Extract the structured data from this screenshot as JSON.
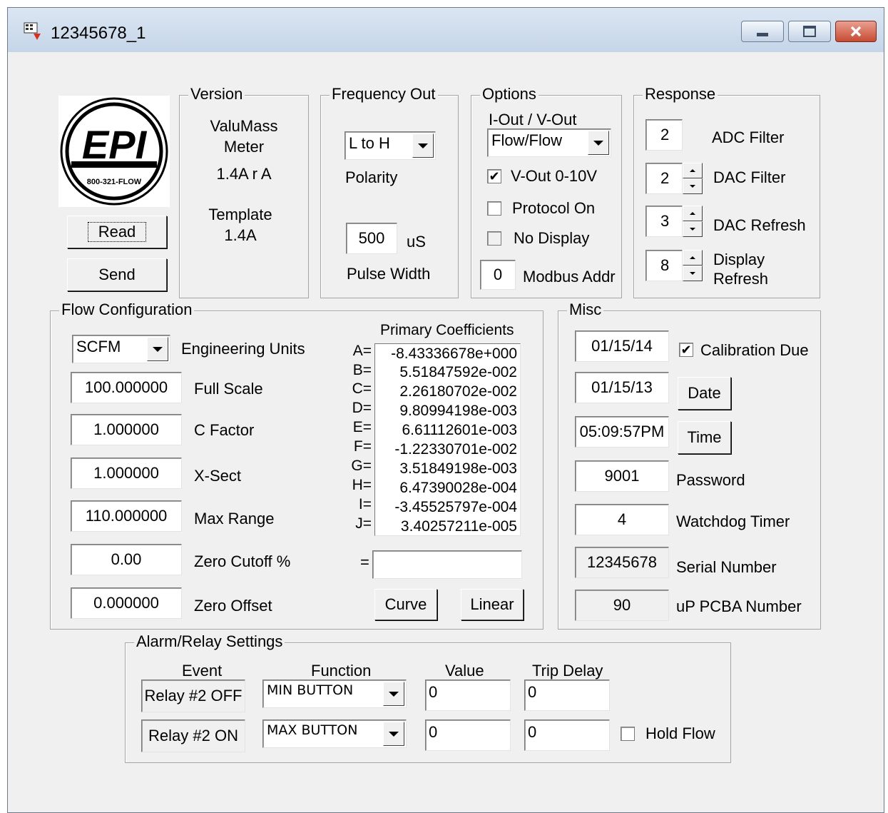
{
  "window": {
    "title": "12345678_1",
    "buttons": {
      "minimize": "minimize",
      "maximize": "maximize",
      "close": "close"
    }
  },
  "logo": {
    "text": "EPI",
    "phone": "800-321-FLOW"
  },
  "actions": {
    "read": "Read",
    "send": "Send"
  },
  "version": {
    "title": "Version",
    "product_line1": "ValuMass",
    "product_line2": "Meter",
    "version": "1.4A r A",
    "template_label": "Template",
    "template_value": "1.4A"
  },
  "frequency_out": {
    "title": "Frequency Out",
    "polarity_value": "L to H",
    "polarity_label": "Polarity",
    "pulse_value": "500",
    "pulse_unit": "uS",
    "pulse_label": "Pulse Width"
  },
  "options": {
    "title": "Options",
    "iout_label": "I-Out / V-Out",
    "iout_value": "Flow/Flow",
    "vout_label": "V-Out 0-10V",
    "vout_checked": true,
    "protocol_label": "Protocol On",
    "protocol_checked": false,
    "nodisplay_label": "No Display",
    "nodisplay_checked": false,
    "modbus_value": "0",
    "modbus_label": "Modbus Addr"
  },
  "response": {
    "title": "Response",
    "adc_value": "2",
    "adc_label": "ADC Filter",
    "dac_value": "2",
    "dac_label": "DAC Filter",
    "refresh_value": "3",
    "refresh_label": "DAC Refresh",
    "display_value": "8",
    "display_label1": "Display",
    "display_label2": "Refresh"
  },
  "flow_config": {
    "title": "Flow Configuration",
    "units_value": "SCFM",
    "units_label": "Engineering Units",
    "full_scale_value": "100.000000",
    "full_scale_label": "Full Scale",
    "c_factor_value": "1.000000",
    "c_factor_label": "C Factor",
    "x_sect_value": "1.000000",
    "x_sect_label": "X-Sect",
    "max_range_value": "110.000000",
    "max_range_label": "Max Range",
    "zero_cutoff_value": "0.00",
    "zero_cutoff_label": "Zero Cutoff %",
    "zero_offset_value": "0.000000",
    "zero_offset_label": "Zero Offset",
    "coef_title": "Primary Coefficients",
    "coefficients": [
      {
        "key": "A=",
        "value": "-8.43336678e+000"
      },
      {
        "key": "B=",
        "value": "5.51847592e-002"
      },
      {
        "key": "C=",
        "value": "2.26180702e-002"
      },
      {
        "key": "D=",
        "value": "9.80994198e-003"
      },
      {
        "key": "E=",
        "value": "6.61112601e-003"
      },
      {
        "key": "F=",
        "value": "-1.22330701e-002"
      },
      {
        "key": "G=",
        "value": "3.51849198e-003"
      },
      {
        "key": "H=",
        "value": "6.47390028e-004"
      },
      {
        "key": "I=",
        "value": "-3.45525797e-004"
      },
      {
        "key": "J=",
        "value": "3.40257211e-005"
      }
    ],
    "equals_label": "=",
    "equals_value": "",
    "curve_button": "Curve",
    "linear_button": "Linear"
  },
  "misc": {
    "title": "Misc",
    "cal_due_value": "01/15/14",
    "cal_due_label": "Calibration Due",
    "cal_due_checked": true,
    "date_value": "01/15/13",
    "date_button": "Date",
    "time_value": "05:09:57PM",
    "time_button": "Time",
    "password_value": "9001",
    "password_label": "Password",
    "watchdog_value": "4",
    "watchdog_label": "Watchdog Timer",
    "serial_value": "12345678",
    "serial_label": "Serial Number",
    "pcba_value": "90",
    "pcba_label": "uP PCBA Number"
  },
  "alarm": {
    "title": "Alarm/Relay Settings",
    "col_event": "Event",
    "col_function": "Function",
    "col_value": "Value",
    "col_trip": "Trip Delay",
    "rows": [
      {
        "event": "Relay #2 OFF",
        "function": "MIN BUTTON",
        "value": "0",
        "trip": "0"
      },
      {
        "event": "Relay #2 ON",
        "function": "MAX BUTTON",
        "value": "0",
        "trip": "0"
      }
    ],
    "hold_flow_label": "Hold Flow",
    "hold_flow_checked": false
  },
  "colors": {
    "titlebar": "#c5d5e8",
    "face": "#f0f0f0",
    "close_button": "#c74a33"
  }
}
